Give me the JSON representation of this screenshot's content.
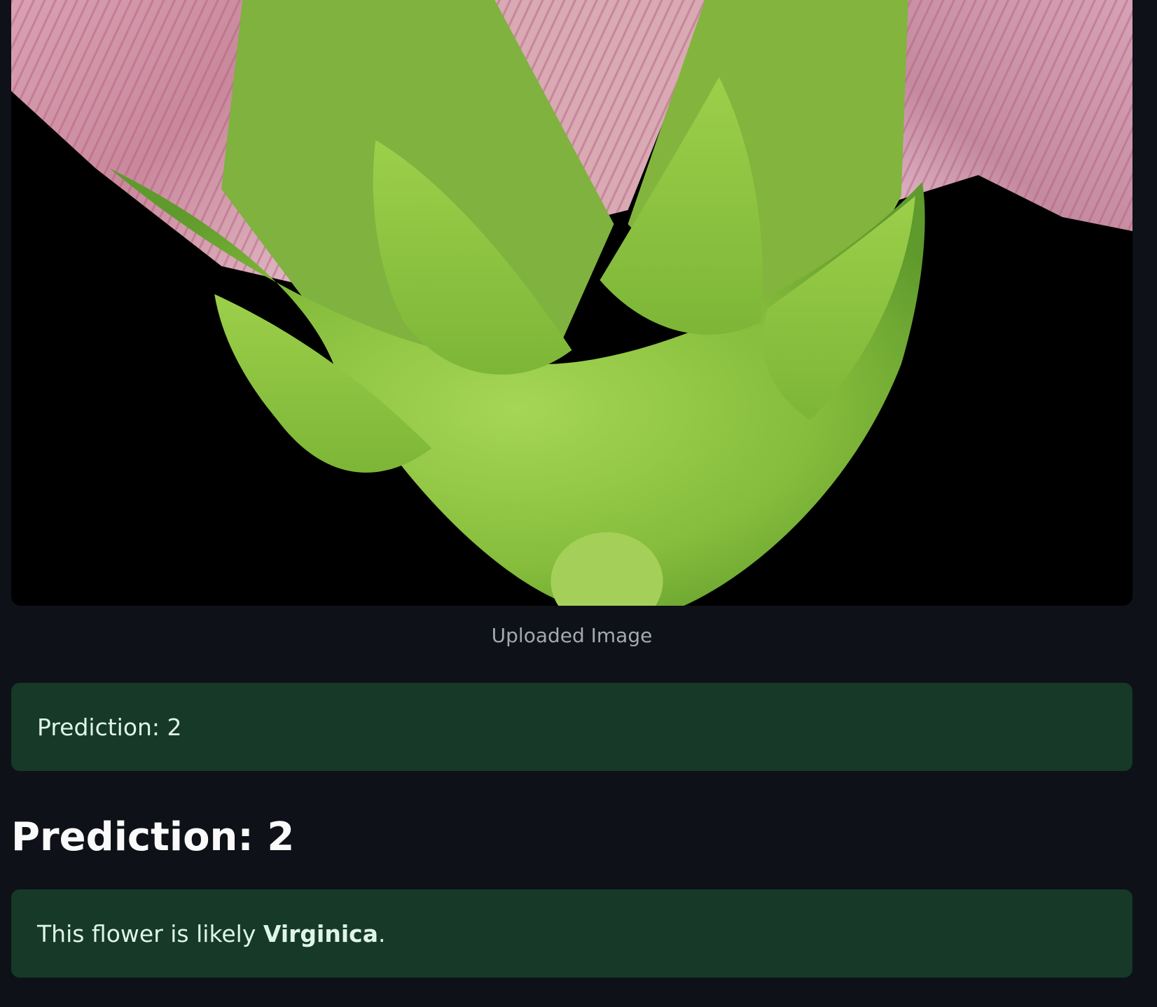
{
  "uploaded_image": {
    "caption": "Uploaded Image"
  },
  "prediction_alert": {
    "text": "Prediction: 2"
  },
  "prediction_heading": {
    "text": "Prediction: 2"
  },
  "result_alert": {
    "prefix": "This flower is likely ",
    "species": "Virginica",
    "suffix": "."
  },
  "colors": {
    "background": "#0e1117",
    "success_bg": "#173928",
    "success_text": "#dff5e6",
    "caption_text": "#a3a8b4",
    "heading_text": "#fafafa"
  }
}
